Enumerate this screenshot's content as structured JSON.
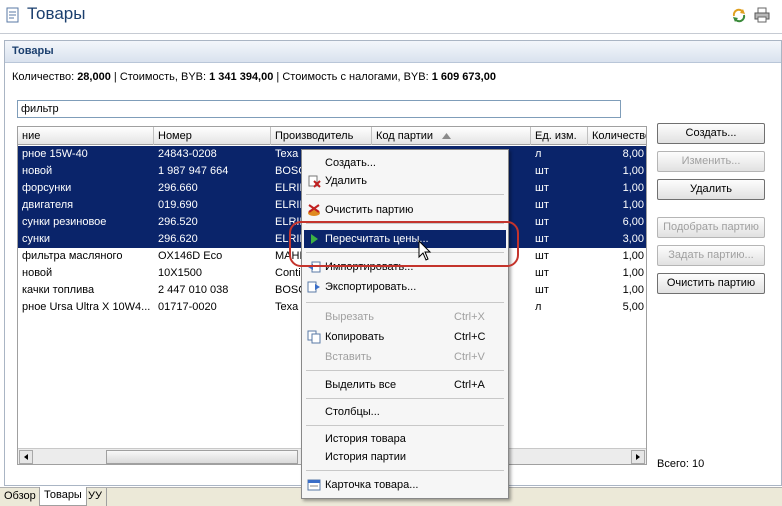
{
  "window": {
    "title": "Товары"
  },
  "panel": {
    "title": "Товары"
  },
  "summary": {
    "qty_label": "Количество: ",
    "qty_value": "28,000",
    "cost_label": " | Стоимость, BYB: ",
    "cost_value": "1 341 394,00",
    "cost_tax_label": " | Стоимость с налогами, BYB: ",
    "cost_tax_value": "1 609 673,00"
  },
  "filter": {
    "value": "фильтр"
  },
  "grid": {
    "columns": [
      "ние",
      "Номер",
      "Производитель",
      "Код партии",
      "Ед. изм.",
      "Количество"
    ],
    "rows": [
      {
        "name": "рное 15W-40",
        "number": "24843-0208",
        "maker": "Texa",
        "lot": "",
        "unit": "л",
        "qty": "8,00",
        "selected": true
      },
      {
        "name": "новой",
        "number": "1 987 947 664",
        "maker": "BOSC",
        "lot": "",
        "unit": "шт",
        "qty": "1,00",
        "selected": true
      },
      {
        "name": "форсунки",
        "number": "296.660",
        "maker": "ELRIN",
        "lot": "",
        "unit": "шт",
        "qty": "1,00",
        "selected": true
      },
      {
        "name": "двигателя",
        "number": "019.690",
        "maker": "ELRIN",
        "lot": "",
        "unit": "шт",
        "qty": "1,00",
        "selected": true
      },
      {
        "name": "сунки резиновое",
        "number": "296.520",
        "maker": "ELRIN",
        "lot": "",
        "unit": "шт",
        "qty": "6,00",
        "selected": true
      },
      {
        "name": "сунки",
        "number": "296.620",
        "maker": "ELRIN",
        "lot": "",
        "unit": "шт",
        "qty": "3,00",
        "selected": true
      },
      {
        "name": "фильтра масляного",
        "number": "OX146D Eco",
        "maker": "MAHL",
        "lot": "",
        "unit": "шт",
        "qty": "1,00",
        "selected": false
      },
      {
        "name": "новой",
        "number": "10X1500",
        "maker": "Conti",
        "lot": "",
        "unit": "шт",
        "qty": "1,00",
        "selected": false
      },
      {
        "name": "качки топлива",
        "number": "2 447 010 038",
        "maker": "BOSC",
        "lot": "",
        "unit": "шт",
        "qty": "1,00",
        "selected": false
      },
      {
        "name": "рное Ursa Ultra X 10W4...",
        "number": "01717-0020",
        "maker": "Texa",
        "lot": "",
        "unit": "л",
        "qty": "5,00",
        "selected": false
      }
    ]
  },
  "buttons": {
    "create": "Создать...",
    "edit": "Изменить...",
    "delete": "Удалить",
    "pick_lot": "Подобрать партию",
    "set_lot": "Задать партию...",
    "clear_lot": "Очистить партию"
  },
  "total": "Всего: 10",
  "tabs": [
    "Обзор",
    "Товары",
    "УУ"
  ],
  "context_menu": {
    "create": "Создать...",
    "delete": "Удалить",
    "clear_lot": "Очистить партию",
    "recalc": "Пересчитать цены...",
    "import": "Импортировать...",
    "export": "Экспортировать...",
    "cut": "Вырезать",
    "cut_sc": "Ctrl+X",
    "copy": "Копировать",
    "copy_sc": "Ctrl+C",
    "paste": "Вставить",
    "paste_sc": "Ctrl+V",
    "select_all": "Выделить все",
    "select_all_sc": "Ctrl+A",
    "columns": "Столбцы...",
    "item_history": "История товара",
    "lot_history": "История партии",
    "item_card": "Карточка товара..."
  },
  "colors": {
    "selection": "#0a246a",
    "highlight_ring": "#c4342c",
    "title": "#1b3f6e"
  }
}
